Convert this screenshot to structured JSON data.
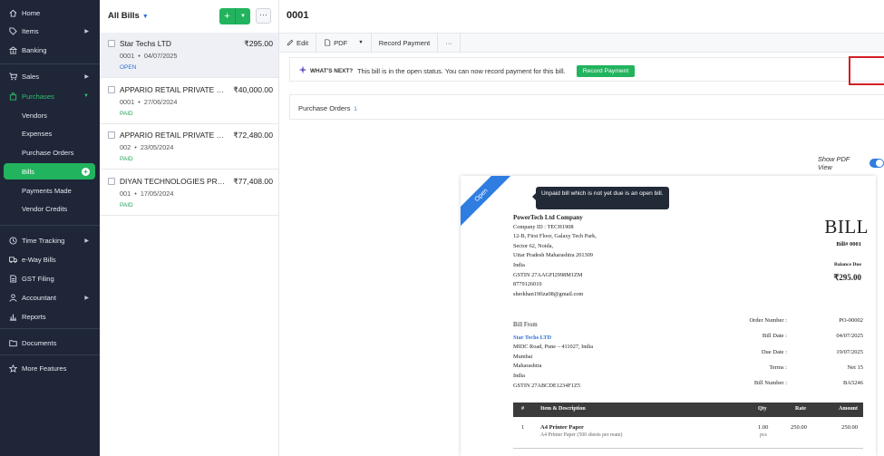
{
  "sidebar": {
    "items": [
      {
        "label": "Home",
        "icon": "home-icon"
      },
      {
        "label": "Items",
        "icon": "tag-icon"
      },
      {
        "label": "Banking",
        "icon": "bank-icon"
      },
      {
        "label": "Sales",
        "icon": "cart-icon"
      },
      {
        "label": "Purchases",
        "icon": "bag-icon"
      },
      {
        "label": "Vendors"
      },
      {
        "label": "Expenses"
      },
      {
        "label": "Purchase Orders"
      },
      {
        "label": "Bills"
      },
      {
        "label": "Payments Made"
      },
      {
        "label": "Vendor Credits"
      },
      {
        "label": "Time Tracking",
        "icon": "clock-icon"
      },
      {
        "label": "e-Way Bills",
        "icon": "truck-icon"
      },
      {
        "label": "GST Filing",
        "icon": "doc-icon"
      },
      {
        "label": "Accountant",
        "icon": "person-icon"
      },
      {
        "label": "Reports",
        "icon": "chart-icon"
      },
      {
        "label": "Documents",
        "icon": "folder-icon"
      },
      {
        "label": "More Features",
        "icon": "star-icon"
      }
    ],
    "accent": "#22b35e",
    "bg": "#1f2638"
  },
  "list": {
    "title": "All Bills",
    "bills": [
      {
        "vendor": "Star Techs LTD",
        "amount": "₹295.00",
        "number": "0001",
        "date": "04/07/2025",
        "status": "OPEN"
      },
      {
        "vendor": "APPARIO RETAIL PRIVATE LIMITED",
        "amount": "₹40,000.00",
        "number": "0001",
        "date": "27/06/2024",
        "status": "PAID"
      },
      {
        "vendor": "APPARIO RETAIL PRIVATE LIMITED",
        "amount": "₹72,480.00",
        "number": "002",
        "date": "23/05/2024",
        "status": "PAID"
      },
      {
        "vendor": "DIYAN TECHNOLOGIES PRIVATE LIMITED",
        "amount": "₹77,408.00",
        "number": "001",
        "date": "17/05/2024",
        "status": "PAID"
      }
    ]
  },
  "detail": {
    "title": "0001",
    "toolbar": {
      "edit": "Edit",
      "pdf": "PDF",
      "record_payment": "Record Payment",
      "more": "···"
    },
    "whats_next": {
      "label": "WHAT'S NEXT?",
      "message": "This bill is in the open status. You can now record payment for this bill.",
      "button": "Record Payment"
    },
    "purchase_orders": {
      "label": "Purchase Orders",
      "count": "1"
    },
    "pdf_view_label": "Show PDF View"
  },
  "document": {
    "ribbon": "Open",
    "tooltip": "Unpaid bill which is not yet due is an open bill.",
    "company": {
      "name": "PowerTech Ltd Company",
      "lines": [
        "Company ID : TECH1908",
        "12-B, First Floor, Galaxy Tech Park,",
        "Sector 62, Noida,",
        "Uttar Pradesh Maharashtra 201309",
        "India",
        "GSTIN 27AAGFI2998M1ZM",
        "8779126010",
        "sherkhan19fiza08@gmail.com"
      ]
    },
    "heading": "BILL",
    "bill_no": "Bill# 0001",
    "balance_label": "Balance Due",
    "balance": "₹295.00",
    "bill_from_label": "Bill From",
    "vendor": {
      "name": "Star Techs LTD",
      "lines": [
        "MIDC Road, Pune – 411027, India",
        "Mumbai",
        " Maharashtra",
        "India",
        "GSTIN 27ABCDE1234F1Z5"
      ]
    },
    "fields": [
      {
        "k": "Order Number :",
        "v": "PO-00002"
      },
      {
        "k": "Bill Date :",
        "v": "04/07/2025"
      },
      {
        "k": "Due Date :",
        "v": "19/07/2025"
      },
      {
        "k": "Terms :",
        "v": "Net 15"
      },
      {
        "k": "Bill Number :",
        "v": "BA5246"
      }
    ],
    "table": {
      "headers": [
        "#",
        "Item & Description",
        "Qty",
        "Rate",
        "Amount"
      ],
      "rows": [
        {
          "n": "1",
          "item": "A4 Printer Paper",
          "desc": "A4 Printer Paper (500 sheets per ream)",
          "qty": "1.00",
          "unit": "pcs",
          "rate": "250.00",
          "amount": "250.00"
        }
      ]
    }
  }
}
